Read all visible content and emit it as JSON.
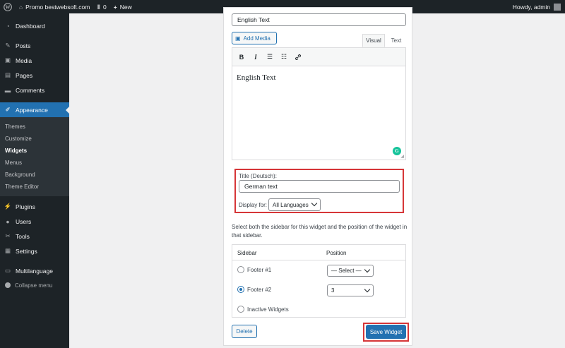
{
  "adminbar": {
    "site_name": "Promo bestwebsoft.com",
    "comments_count": "0",
    "new_label": "New",
    "howdy": "Howdy, admin"
  },
  "menu": {
    "dashboard": "Dashboard",
    "posts": "Posts",
    "media": "Media",
    "pages": "Pages",
    "comments": "Comments",
    "appearance": "Appearance",
    "sub": [
      "Themes",
      "Customize",
      "Widgets",
      "Menus",
      "Background",
      "Theme Editor"
    ],
    "plugins": "Plugins",
    "users": "Users",
    "tools": "Tools",
    "settings": "Settings",
    "multilanguage": "Multilanguage",
    "collapse": "Collapse menu"
  },
  "widget": {
    "title_value": "English Text",
    "add_media": "Add Media",
    "tab_visual": "Visual",
    "tab_text": "Text",
    "editor_content": "English Text",
    "title_de_label": "Title (Deutsch):",
    "title_de_value": "German text",
    "display_for_label": "Display for:",
    "display_for_value": "All Languages",
    "sidebar_desc": "Select both the sidebar for this widget and the position of the widget in that sidebar.",
    "col_sidebar": "Sidebar",
    "col_position": "Position",
    "rows": [
      {
        "label": "Footer #1",
        "position": "— Select —"
      },
      {
        "label": "Footer #2",
        "position": "3"
      },
      {
        "label": "Inactive Widgets"
      }
    ],
    "delete": "Delete",
    "save": "Save Widget"
  },
  "colors": {
    "accent": "#2271b1",
    "highlight": "#d63638",
    "adminbar": "#1d2327"
  }
}
